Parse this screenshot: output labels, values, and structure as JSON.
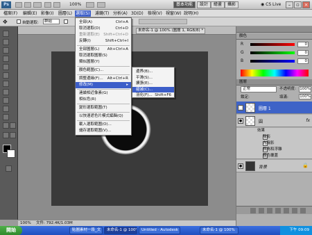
{
  "app": {
    "logo": "Ps",
    "zoom": "100%",
    "live": "CS Live",
    "workspace_buttons": [
      "基本功能",
      "設計",
      "繪畫",
      "攝影"
    ]
  },
  "menubar": [
    "檔案(F)",
    "編輯(E)",
    "影像(I)",
    "圖層(L)",
    "選取(S)",
    "濾鏡(T)",
    "分析(A)",
    "3D(D)",
    "檢視(V)",
    "視窗(W)",
    "說明(H)"
  ],
  "optionsbar": {
    "auto_select": "自動選取:",
    "auto_select_value": "群組"
  },
  "doc": {
    "tab": "未命名-1 @ 100% (圖層 1, RGB/8) *",
    "status_zoom": "100%",
    "status_doc": "文件: 792.4K/1.03M"
  },
  "select_menu": {
    "items": [
      {
        "label": "全部(A)",
        "shortcut": "Ctrl+A",
        "state": "normal"
      },
      {
        "label": "取消選取(D)",
        "shortcut": "Ctrl+D",
        "state": "normal"
      },
      {
        "label": "重新選取(E)",
        "shortcut": "Shift+Ctrl+D",
        "state": "disabled"
      },
      {
        "label": "反轉(I)",
        "shortcut": "Shift+Ctrl+I",
        "state": "normal"
      },
      {
        "label": "全部圖層(L)",
        "shortcut": "Alt+Ctrl+A",
        "state": "normal"
      },
      {
        "label": "取消選取圖層(S)",
        "shortcut": "",
        "state": "normal"
      },
      {
        "label": "類似圖層(Y)",
        "shortcut": "",
        "state": "normal"
      },
      {
        "label": "顏色範圍(C)...",
        "shortcut": "",
        "state": "normal"
      },
      {
        "label": "調整邊緣(F)...",
        "shortcut": "Alt+Ctrl+R",
        "state": "normal"
      },
      {
        "label": "修改(M)",
        "shortcut": "▸",
        "state": "highlight"
      },
      {
        "label": "連續相近像素(G)",
        "shortcut": "",
        "state": "normal"
      },
      {
        "label": "相似色(R)",
        "shortcut": "",
        "state": "normal"
      },
      {
        "label": "變形選取範圍(T)",
        "shortcut": "",
        "state": "normal"
      },
      {
        "label": "以快速遮色片模式編輯(Q)",
        "shortcut": "",
        "state": "normal"
      },
      {
        "label": "載入選取範圍(O)...",
        "shortcut": "",
        "state": "normal"
      },
      {
        "label": "儲存選取範圍(V)...",
        "shortcut": "",
        "state": "normal"
      }
    ]
  },
  "modify_menu": {
    "items": [
      {
        "label": "邊界(B)...",
        "shortcut": "",
        "state": "normal"
      },
      {
        "label": "平滑(S)...",
        "shortcut": "",
        "state": "normal"
      },
      {
        "label": "擴張(E)...",
        "shortcut": "",
        "state": "normal"
      },
      {
        "label": "縮減(C)...",
        "shortcut": "",
        "state": "highlight"
      },
      {
        "label": "羽化(F)...",
        "shortcut": "Shift+F6",
        "state": "normal"
      }
    ]
  },
  "color_panel": {
    "tab": "顏色",
    "channels": [
      {
        "label": "R",
        "value": "0"
      },
      {
        "label": "G",
        "value": "0"
      },
      {
        "label": "B",
        "value": "0"
      }
    ]
  },
  "layers_panel": {
    "tab": "圖層",
    "blend_mode": "正常",
    "opacity_label": "不透明度:",
    "opacity": "100%",
    "lock_label": "鎖定:",
    "fill_label": "填滿:",
    "fill": "100%",
    "layers": [
      {
        "name": "圖層 1",
        "selected": true,
        "fx": ""
      },
      {
        "name": "圓",
        "selected": false,
        "fx": "fx"
      }
    ],
    "effects_header": "效果",
    "effects": [
      "陰影",
      "內陰影",
      "斜角和浮雕",
      "顏色覆蓋"
    ],
    "background": "背景"
  },
  "taskbar": {
    "start": "開始",
    "tasks": [
      "貼圖素材一段_文",
      "未命名-1 @ 100%",
      "Untitled - Autodesk",
      "未命名-1 @ 100%"
    ],
    "clock": "下午 09:09"
  }
}
